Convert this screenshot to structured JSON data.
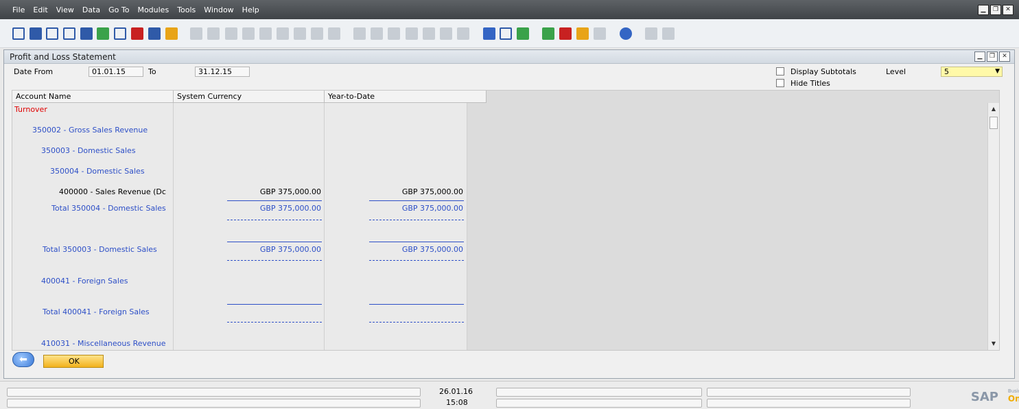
{
  "menu": [
    "File",
    "Edit",
    "View",
    "Data",
    "Go To",
    "Modules",
    "Tools",
    "Window",
    "Help"
  ],
  "window": {
    "title": "Profit and Loss Statement"
  },
  "filters": {
    "date_from_label": "Date From",
    "date_from": "01.01.15",
    "to_label": "To",
    "date_to": "31.12.15",
    "display_subtotals_label": "Display Subtotals",
    "hide_titles_label": "Hide Titles",
    "level_label": "Level",
    "level_value": "5"
  },
  "table": {
    "headers": [
      "Account Name",
      "System Currency",
      "Year-to-Date"
    ],
    "rows": [
      {
        "name": "Turnover",
        "sys": "",
        "ytd": ""
      },
      {
        "name": "350002 - Gross Sales Revenue",
        "sys": "",
        "ytd": ""
      },
      {
        "name": "350003 - Domestic Sales",
        "sys": "",
        "ytd": ""
      },
      {
        "name": "350004 - Domestic Sales",
        "sys": "",
        "ytd": ""
      },
      {
        "name": "400000 - Sales Revenue (Dc",
        "sys": "GBP 375,000.00",
        "ytd": "GBP 375,000.00"
      },
      {
        "name": "Total 350004 - Domestic Sales",
        "sys": "GBP 375,000.00",
        "ytd": "GBP 375,000.00"
      },
      {
        "name": "Total 350003 - Domestic Sales",
        "sys": "GBP 375,000.00",
        "ytd": "GBP 375,000.00"
      },
      {
        "name": "400041 - Foreign Sales",
        "sys": "",
        "ytd": ""
      },
      {
        "name": "Total 400041 - Foreign Sales",
        "sys": "",
        "ytd": ""
      },
      {
        "name": "410031 - Miscellaneous Revenue",
        "sys": "",
        "ytd": ""
      }
    ]
  },
  "buttons": {
    "ok": "OK"
  },
  "status": {
    "date": "26.01.16",
    "time": "15:08"
  },
  "logo": {
    "sap": "SAP",
    "business": "Business",
    "one": "One"
  }
}
